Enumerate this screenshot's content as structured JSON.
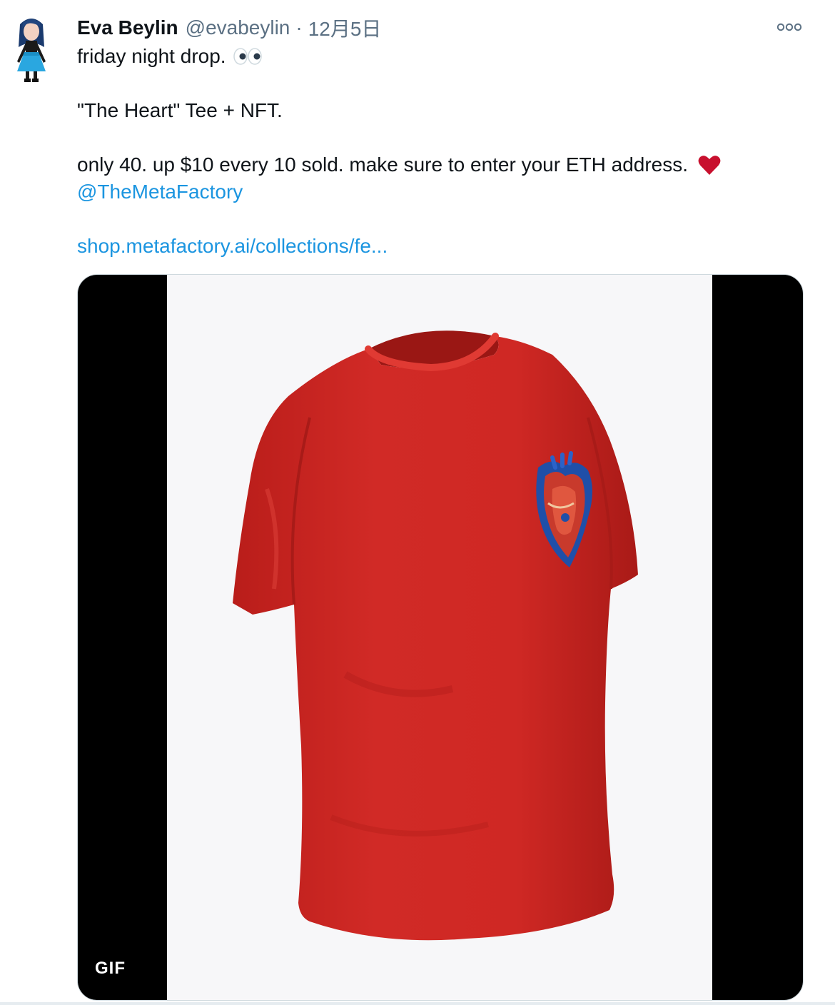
{
  "author": {
    "name": "Eva Beylin",
    "handle": "@evabeylin",
    "separator": "·",
    "date": "12月5日"
  },
  "tweet": {
    "line1": "friday night drop.",
    "line1_emoji": "eyes-icon",
    "line2": "\"The Heart\" Tee + NFT.",
    "line3": "only 40. up $10 every 10 sold. make sure to enter your ETH address.",
    "line3_emoji": "red-heart-icon",
    "mention": "@TheMetaFactory",
    "link": "shop.metafactory.ai/collections/fe..."
  },
  "media": {
    "badge": "GIF",
    "subject": "red t-shirt with embroidered anatomical heart patch"
  },
  "colors": {
    "link": "#1b95e0",
    "secondary_text": "#5b7083",
    "shirt": "#d12a26",
    "heart_emoji": "#c8102e"
  },
  "icons": {
    "more": "more-options-icon"
  }
}
